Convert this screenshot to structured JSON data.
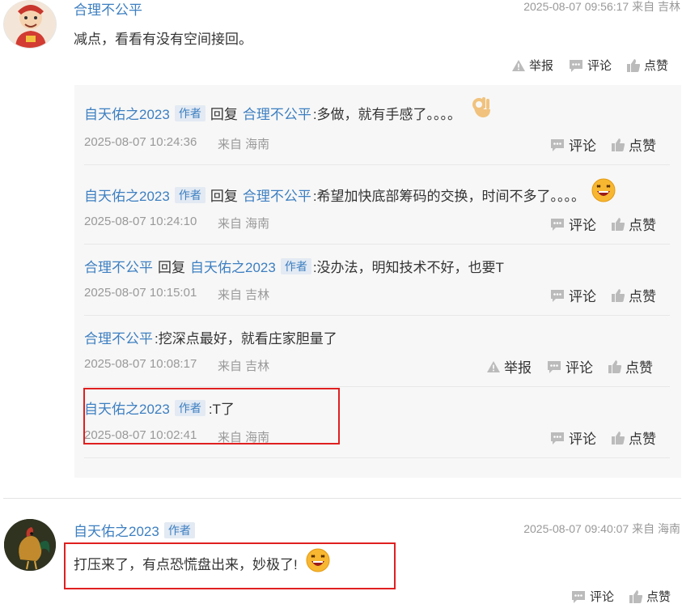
{
  "top_comment": {
    "user": "合理不公平",
    "meta": "2025-08-07 09:56:17 来自 吉林",
    "text": "减点，看看有没有空间接回。",
    "report": "举报",
    "comment": "评论",
    "like": "点赞"
  },
  "replies": [
    {
      "user1": "自天佑之2023",
      "badge1": "作者",
      "verb": "回复",
      "user2": "合理不公平",
      "text": ":多做，就有手感了。。。。",
      "time": "2025-08-07 10:24:36",
      "loc": "来自 海南",
      "comment": "评论",
      "like": "点赞"
    },
    {
      "user1": "自天佑之2023",
      "badge1": "作者",
      "verb": "回复",
      "user2": "合理不公平",
      "text": ":希望加快底部筹码的交换，时间不多了。。。。",
      "time": "2025-08-07 10:24:10",
      "loc": "来自 海南",
      "comment": "评论",
      "like": "点赞"
    },
    {
      "user1": "合理不公平",
      "verb": "回复",
      "user2": "自天佑之2023",
      "badge2": "作者",
      "text": ":没办法，明知技术不好，也要T",
      "time": "2025-08-07 10:15:01",
      "loc": "来自 吉林",
      "comment": "评论",
      "like": "点赞"
    },
    {
      "user1": "合理不公平",
      "text": ":挖深点最好，就看庄家胆量了",
      "time": "2025-08-07 10:08:17",
      "loc": "来自 吉林",
      "report": "举报",
      "comment": "评论",
      "like": "点赞"
    },
    {
      "user1": "自天佑之2023",
      "badge1": "作者",
      "text": ":T了",
      "time": "2025-08-07 10:02:41",
      "loc": "来自 海南",
      "comment": "评论",
      "like": "点赞"
    }
  ],
  "second_comment": {
    "user": "自天佑之2023",
    "badge": "作者",
    "meta": "2025-08-07 09:40:07 来自 海南",
    "text": "打压来了，有点恐慌盘出来，妙极了!",
    "comment": "评论",
    "like": "点赞"
  },
  "icons": {
    "report": "warning-icon",
    "comment": "comment-icon",
    "like": "thumbs-up-icon",
    "emoji_ok": "ok-hand-emoji",
    "emoji_laugh": "laughing-emoji"
  },
  "colors": {
    "link": "#3d7fc1",
    "badge_bg": "#e3eaf3",
    "reply_bg": "#f7f7f7",
    "highlight": "#e02020"
  }
}
